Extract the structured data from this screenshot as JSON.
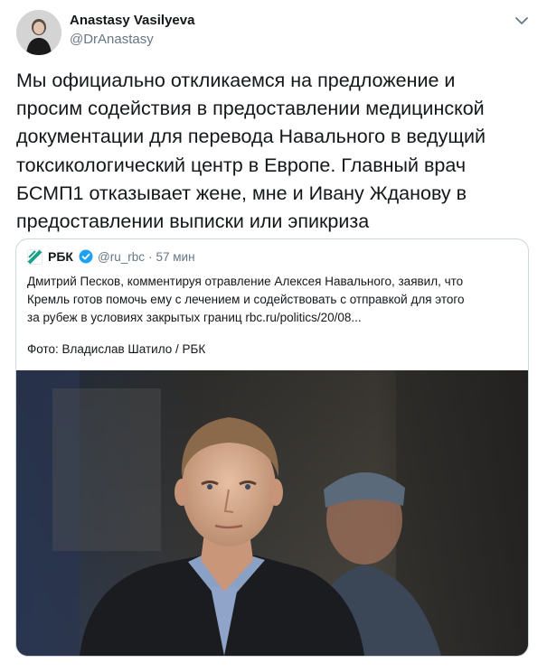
{
  "tweet": {
    "author_name": "Anastasy Vasilyeva",
    "author_handle": "@DrAnastasy",
    "text": "Мы официально откликаемся на предложение и\nпросим содействия в предоставлении медицинской\nдокументации для перевода Навального в ведущий\nтоксикологический центр в Европе. Главный врач\nБСМП1 отказывает жене, мне и Ивану Жданову в\nпредоставлении выписки или эпикриза"
  },
  "quote": {
    "author_name": "РБК",
    "author_handle": "@ru_rbc",
    "separator": "·",
    "time": "57 мин",
    "text": "Дмитрий Песков, комментируя отравление Алексея Навального, заявил, что\nКремль готов помочь ему с лечением и содействовать с отправкой для этого\nза рубеж в условиях закрытых границ rbc.ru/politics/20/08...",
    "caption": "Фото: Владислав Шатило / РБК"
  },
  "icons": {
    "avatar": "avatar-photo",
    "menu": "chevron-down-icon",
    "quote_logo": "rbc-logo-icon",
    "verified": "verified-badge-icon"
  },
  "colors": {
    "text": "#14171a",
    "secondary": "#657786",
    "border": "#ccd6dd",
    "verified": "#1da1f2",
    "rbc_logo": "#1e9e8a"
  }
}
